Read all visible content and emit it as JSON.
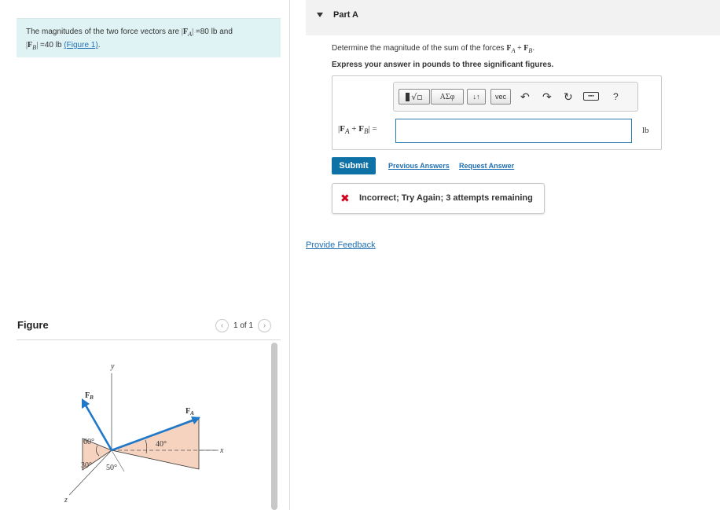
{
  "problem": {
    "text_1": "The magnitudes of the two force vectors are",
    "fa_symbol": "F",
    "fa_sub": "A",
    "fa_value": "=80 lb",
    "and": "and",
    "fb_symbol": "F",
    "fb_sub": "B",
    "fb_value": "=40 lb",
    "figure_link": "(Figure 1)",
    "end": "."
  },
  "figure": {
    "label": "Figure",
    "pager": "1 of 1",
    "prev_icon": "chevron-left-icon",
    "next_icon": "chevron-right-icon",
    "axis_x": "x",
    "axis_y": "y",
    "axis_z": "z",
    "vec_a": "F",
    "vec_a_sub": "A",
    "vec_b": "F",
    "vec_b_sub": "B",
    "angle_60": "60°",
    "angle_30": "30°",
    "angle_50": "50°",
    "angle_40": "40°",
    "colors": {
      "vector": "#1f78c8",
      "plane": "#f6d3bf",
      "plane_stroke": "#333333"
    }
  },
  "part": {
    "caret_icon": "triangle-down-icon",
    "title": "Part A",
    "question_prefix": "Determine the magnitude of the sum of the forces",
    "question_fa": "F",
    "question_fa_sub": "A",
    "question_plus": "+",
    "question_fb": "F",
    "question_fb_sub": "B",
    "question_end": ".",
    "instruction": "Express your answer in pounds to three significant figures."
  },
  "toolbar": {
    "templates_icon": "templates-icon",
    "symbols_label": "ΑΣφ",
    "arrows_label": "↓↑",
    "vec_label": "vec",
    "undo_icon": "undo-icon",
    "redo_icon": "redo-icon",
    "reset_icon": "reset-icon",
    "keyboard_icon": "keyboard-icon",
    "help_label": "?"
  },
  "answer": {
    "label_open": "|",
    "label_fa": "F",
    "label_fa_sub": "A",
    "label_plus": "+",
    "label_fb": "F",
    "label_fb_sub": "B",
    "label_close": "| =",
    "value": "",
    "unit": "lb"
  },
  "actions": {
    "submit": "Submit",
    "previous_answers": "Previous Answers",
    "request_answer": "Request Answer"
  },
  "feedback": {
    "icon": "x-icon",
    "text": "Incorrect; Try Again; 3 attempts remaining",
    "color": "#d0021b"
  },
  "provide_feedback": "Provide Feedback"
}
